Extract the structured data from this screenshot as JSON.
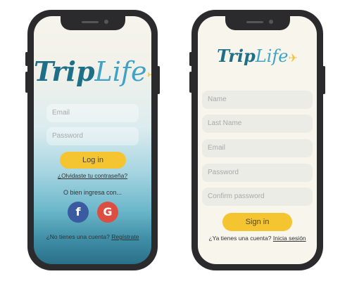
{
  "colors": {
    "accent": "#f4c530",
    "brand_dark": "#1e6f88",
    "brand_light": "#3ea3c6",
    "facebook": "#3b5ba1",
    "google": "#dc4e41"
  },
  "login_screen": {
    "logo": {
      "part1": "Trip",
      "part2": "Life"
    },
    "email_placeholder": "Email",
    "password_placeholder": "Password",
    "login_label": "Log in",
    "forgot_link": "¿Olvidaste tu contraseña?",
    "or_text": "O bien ingresa con...",
    "social": {
      "facebook_glyph": "f",
      "google_glyph": "G"
    },
    "signup_prompt": "¿No tienes una cuenta?",
    "signup_link": "Regístrate"
  },
  "signup_screen": {
    "logo": {
      "part1": "Trip",
      "part2": "Life"
    },
    "name_placeholder": "Name",
    "last_name_placeholder": "Last Name",
    "email_placeholder": "Email",
    "password_placeholder": "Password",
    "confirm_password_placeholder": "Confirm password",
    "signin_label": "Sign in",
    "login_prompt": "¿Ya tienes una cuenta?",
    "login_link": "Inicia sesión"
  }
}
